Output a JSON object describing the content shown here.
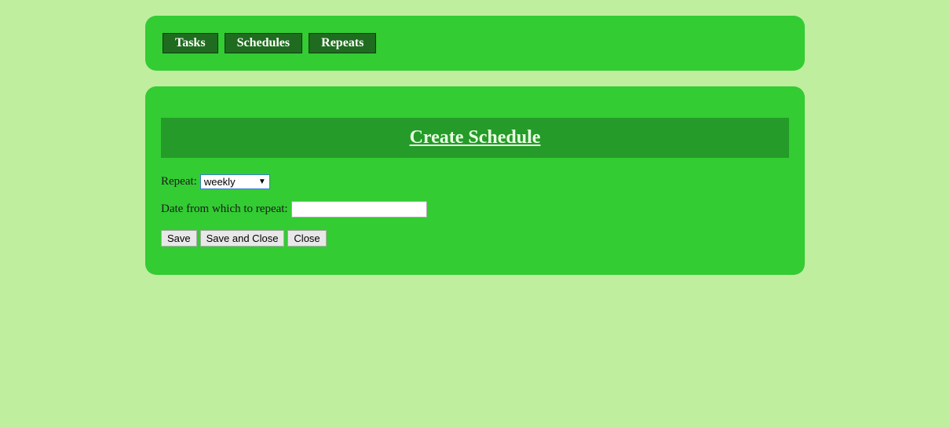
{
  "nav": {
    "items": [
      {
        "label": "Tasks"
      },
      {
        "label": "Schedules"
      },
      {
        "label": "Repeats"
      }
    ]
  },
  "main": {
    "title": "Create Schedule",
    "repeat_label": "Repeat:",
    "repeat_value": "weekly",
    "date_label": "Date from which to repeat:",
    "date_value": "",
    "buttons": {
      "save": "Save",
      "save_close": "Save and Close",
      "close": "Close"
    }
  },
  "colors": {
    "background": "#bfee9f",
    "panel": "#33cc33",
    "title_bar": "#259b29",
    "nav_button": "#1f6b1f"
  }
}
